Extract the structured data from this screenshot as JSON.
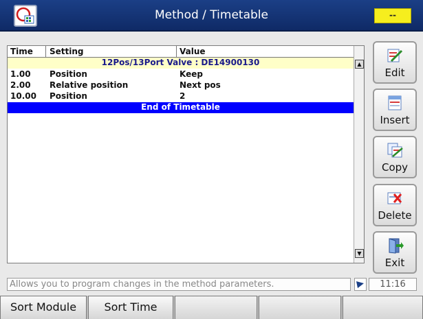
{
  "header": {
    "title": "Method / Timetable",
    "badge": "--"
  },
  "table": {
    "columns": [
      "Time",
      "Setting",
      "Value"
    ],
    "module_row": "12Pos/13Port Valve : DE14900130",
    "rows": [
      {
        "time": "1.00",
        "setting": "Position",
        "value": "Keep"
      },
      {
        "time": "2.00",
        "setting": "Relative position",
        "value": "Next pos"
      },
      {
        "time": "10.00",
        "setting": "Position",
        "value": "2"
      }
    ],
    "end_row": "End of Timetable"
  },
  "side_buttons": {
    "edit": "Edit",
    "insert": "Insert",
    "copy": "Copy",
    "delete": "Delete",
    "exit": "Exit"
  },
  "status": {
    "message": "Allows you to program changes in the method parameters.",
    "clock": "11:16"
  },
  "softkeys": [
    "Sort Module",
    "Sort Time"
  ],
  "colors": {
    "title_bar": "#0f2a66",
    "module_row_bg": "#ffffc8",
    "selected_row_bg": "#0000ff",
    "badge": "#f6ee1e"
  }
}
